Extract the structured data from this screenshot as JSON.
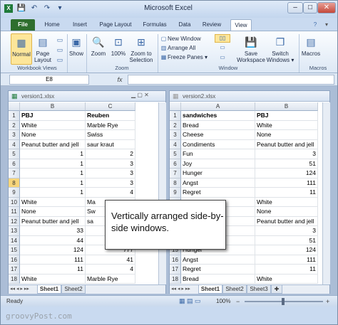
{
  "window": {
    "title": "Microsoft Excel",
    "min": "–",
    "max": "□",
    "close": "✕"
  },
  "qat": [
    "💾",
    "↶",
    "↷",
    "▾"
  ],
  "tabs": [
    "File",
    "Home",
    "Insert",
    "Page Layout",
    "Formulas",
    "Data",
    "Review",
    "View"
  ],
  "ribbon": {
    "normal": "Normal",
    "page_layout": "Page Layout",
    "show": "Show",
    "zoom": "Zoom",
    "zoom100": "100%",
    "zoom_sel": "Zoom to Selection",
    "new_window": "New Window",
    "arrange_all": "Arrange All",
    "freeze": "Freeze Panes ▾",
    "save_ws": "Save Workspace",
    "switch": "Switch Windows ▾",
    "macros": "Macros",
    "groups": {
      "workbook_views": "Workbook Views",
      "zoom": "Zoom",
      "window": "Window",
      "macros": "Macros"
    }
  },
  "formula_bar": {
    "namebox": "E8",
    "fx": "fx",
    "value": ""
  },
  "left_pane": {
    "title": "version1.xlsx",
    "cols": [
      "B",
      "C"
    ],
    "rows": [
      {
        "n": "1",
        "b": "PBJ",
        "c": "Reuben",
        "bold": true
      },
      {
        "n": "2",
        "b": "White",
        "c": "Marble Rye"
      },
      {
        "n": "3",
        "b": "None",
        "c": "Swiss"
      },
      {
        "n": "4",
        "b": "Peanut butter and jell",
        "c": "saur kraut"
      },
      {
        "n": "5",
        "b": "1",
        "c": "2",
        "num": true
      },
      {
        "n": "6",
        "b": "1",
        "c": "3",
        "num": true
      },
      {
        "n": "7",
        "b": "1",
        "c": "3",
        "num": true
      },
      {
        "n": "8",
        "b": "1",
        "c": "3",
        "num": true,
        "sel": true
      },
      {
        "n": "9",
        "b": "1",
        "c": "4",
        "num": true
      },
      {
        "n": "10",
        "b": "White",
        "c": "Ma"
      },
      {
        "n": "11",
        "b": "None",
        "c": "Sw"
      },
      {
        "n": "12",
        "b": "Peanut butter and jell",
        "c": "sa"
      },
      {
        "n": "13",
        "b": "33",
        "c": "",
        "num": true
      },
      {
        "n": "14",
        "b": "44",
        "c": "",
        "num": true
      },
      {
        "n": "15",
        "b": "124",
        "c": "777",
        "num": true
      },
      {
        "n": "16",
        "b": "111",
        "c": "41",
        "num": true
      },
      {
        "n": "17",
        "b": "11",
        "c": "4",
        "num": true
      },
      {
        "n": "18",
        "b": "White",
        "c": "Marble Rye"
      }
    ],
    "sheets": [
      "Sheet1",
      "Sheet2"
    ]
  },
  "right_pane": {
    "title": "version2.xlsx",
    "cols": [
      "A",
      "B"
    ],
    "rows": [
      {
        "n": "1",
        "a": "sandwiches",
        "b": "PBJ",
        "bold": true
      },
      {
        "n": "2",
        "a": "Bread",
        "b": "White"
      },
      {
        "n": "3",
        "a": "Cheese",
        "b": "None"
      },
      {
        "n": "4",
        "a": "Condiments",
        "b": "Peanut butter and jell"
      },
      {
        "n": "5",
        "a": "Fun",
        "b": "3",
        "num": true
      },
      {
        "n": "6",
        "a": "Joy",
        "b": "51",
        "num": true
      },
      {
        "n": "7",
        "a": "Hunger",
        "b": "124",
        "num": true
      },
      {
        "n": "8",
        "a": "Angst",
        "b": "111",
        "num": true
      },
      {
        "n": "9",
        "a": "Regret",
        "b": "11",
        "num": true
      },
      {
        "n": "10",
        "a": "",
        "b": "White"
      },
      {
        "n": "11",
        "a": "",
        "b": "None"
      },
      {
        "n": "12",
        "a": "",
        "b": "Peanut butter and jell"
      },
      {
        "n": "13",
        "a": "",
        "b": "3",
        "num": true
      },
      {
        "n": "14",
        "a": "",
        "b": "51",
        "num": true
      },
      {
        "n": "15",
        "a": "Hunger",
        "b": "124",
        "num": true
      },
      {
        "n": "16",
        "a": "Angst",
        "b": "111",
        "num": true
      },
      {
        "n": "17",
        "a": "Regret",
        "b": "11",
        "num": true
      },
      {
        "n": "18",
        "a": "Bread",
        "b": "White"
      }
    ],
    "sheets": [
      "Sheet1",
      "Sheet2",
      "Sheet3"
    ]
  },
  "callout": "Vertically arranged side-by-side windows.",
  "status": {
    "text": "Ready",
    "zoom": "100%"
  },
  "watermark": "groovyPost.com"
}
